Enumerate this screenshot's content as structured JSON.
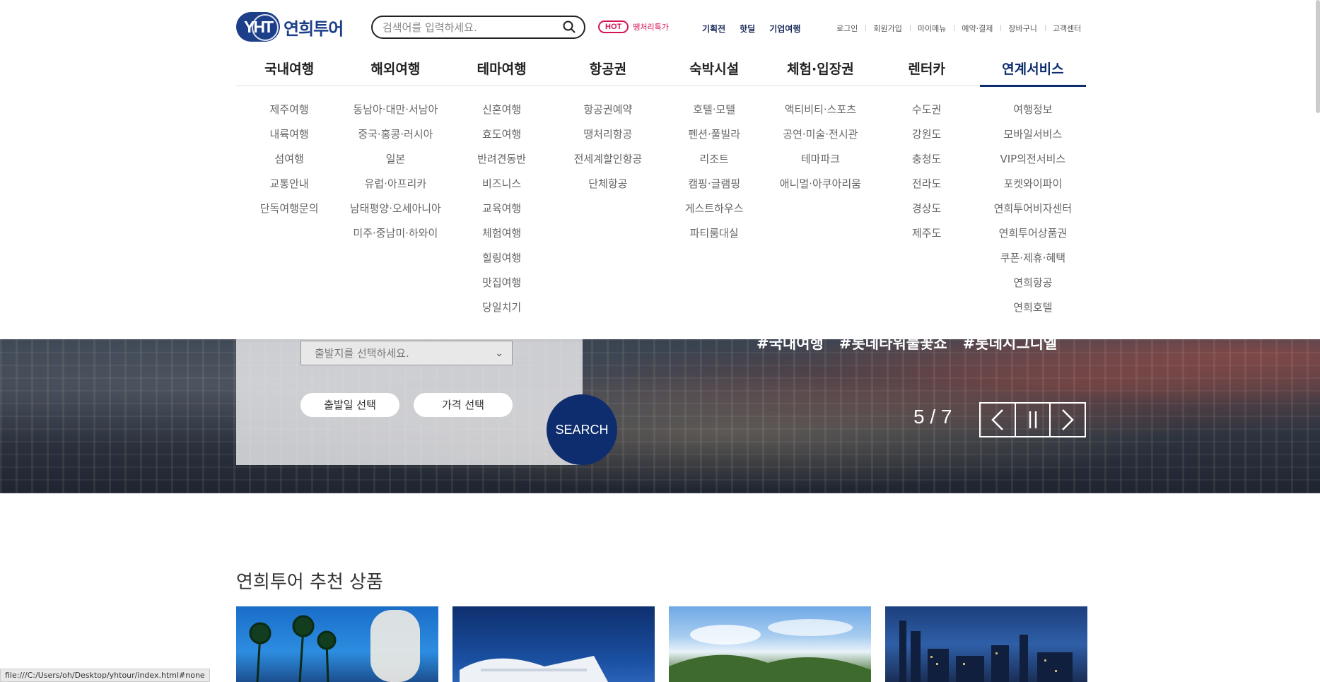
{
  "header": {
    "logo_mark": "YHT",
    "logo_text": "연희투어",
    "search_placeholder": "검색어를 입력하세요.",
    "hot_badge": "HOT",
    "hot_text": "땡처리특가",
    "quick_links": [
      "기획전",
      "핫딜",
      "기업여행"
    ],
    "util_links": [
      "로그인",
      "회원가입",
      "마이메뉴",
      "예약·결제",
      "장바구니",
      "고객센터"
    ]
  },
  "gnb": [
    {
      "label": "국내여행",
      "items": [
        "제주여행",
        "내륙여행",
        "섬여행",
        "교통안내",
        "단독여행문의"
      ]
    },
    {
      "label": "해외여행",
      "items": [
        "동남아·대만·서남아",
        "중국·홍콩·러시아",
        "일본",
        "유럽·아프리카",
        "남태평양·오세아니아",
        "미주·중남미·하와이"
      ]
    },
    {
      "label": "테마여행",
      "items": [
        "신혼여행",
        "효도여행",
        "반려견동반",
        "비즈니스",
        "교육여행",
        "체험여행",
        "힐링여행",
        "맛집여행",
        "당일치기"
      ]
    },
    {
      "label": "항공권",
      "items": [
        "항공권예약",
        "땡처리항공",
        "전세계할인항공",
        "단체항공"
      ]
    },
    {
      "label": "숙박시설",
      "items": [
        "호텔·모텔",
        "펜션·풀빌라",
        "리조트",
        "캠핑·글램핑",
        "게스트하우스",
        "파티룸대실"
      ]
    },
    {
      "label": "체험·입장권",
      "items": [
        "액티비티·스포츠",
        "공연·미술·전시관",
        "테마파크",
        "애니멀·아쿠아리움"
      ]
    },
    {
      "label": "렌터카",
      "items": [
        "수도권",
        "강원도",
        "충청도",
        "전라도",
        "경상도",
        "제주도"
      ]
    },
    {
      "label": "연계서비스",
      "active": true,
      "items": [
        "여행정보",
        "모바일서비스",
        "VIP의전서비스",
        "포켓와이파이",
        "연희투어비자센터",
        "연희투어상품권",
        "쿠폰·제휴·혜택",
        "연희항공",
        "연희호텔"
      ]
    }
  ],
  "hero": {
    "departure_select": "출발지를 선택하세요.",
    "date_button": "출발일 선택",
    "price_button": "가격 선택",
    "search_button": "SEARCH",
    "tags": [
      "#국내여행",
      "#롯데타워불꽃쇼",
      "#롯데시그니엘"
    ],
    "counter": "5 / 7"
  },
  "recommend": {
    "title": "연희투어 추천 상품"
  },
  "status_bar": "file:///C:/Users/oh/Desktop/yhtour/index.html#none",
  "colors": {
    "brand_navy": "#0e2d6e",
    "hot_pink": "#d4145a"
  }
}
